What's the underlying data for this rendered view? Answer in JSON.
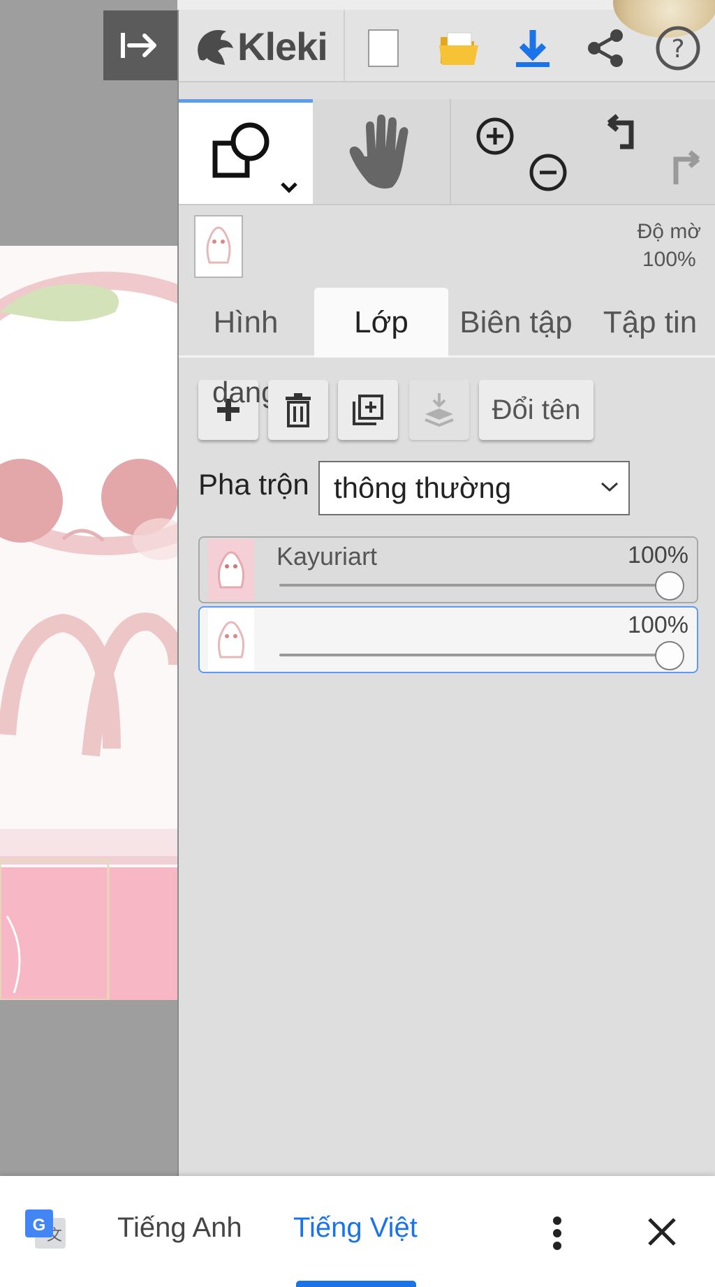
{
  "app": {
    "logo_text": "Kleki"
  },
  "toolbar": {
    "icons": [
      "canvas-toggle-icon",
      "kleki-logo-icon",
      "new-image-icon",
      "open-folder-icon",
      "download-icon",
      "share-icon",
      "help-icon"
    ],
    "accent_color": "#1a73e8"
  },
  "layer_preview": {
    "opacity_label": "Độ mờ",
    "opacity_value": "100%"
  },
  "tabs": [
    {
      "label": "Hình",
      "active": false
    },
    {
      "label": "Lớp",
      "active": true
    },
    {
      "label": "Biên tập",
      "active": false
    },
    {
      "label": "Tập tin",
      "active": false
    }
  ],
  "layer_controls": {
    "add_overlay_text": "dang",
    "rename_label": "Đổi tên",
    "blend_label": "Pha trộn",
    "blend_value": "thông thường"
  },
  "layers": [
    {
      "name": "Kayuriart",
      "opacity": "100%",
      "opacity_fraction": 1.0,
      "selected": false
    },
    {
      "name": "",
      "opacity": "100%",
      "opacity_fraction": 1.0,
      "selected": true
    }
  ],
  "translate_bar": {
    "source_language": "Tiếng Anh",
    "target_language": "Tiếng Việt",
    "active_color": "#1a73e8"
  }
}
